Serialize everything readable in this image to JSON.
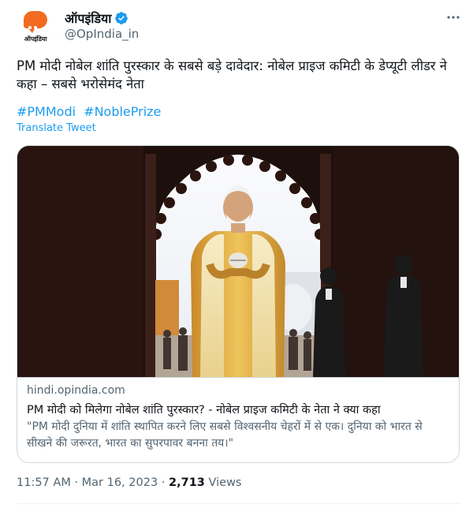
{
  "author": {
    "display_name": "ऑपइंडिया",
    "handle": "@OpIndia_in",
    "avatar_text": "ऑपइंडिया",
    "verified": true
  },
  "tweet": {
    "text": "PM मोदी नोबेल शांति पुरस्कार के सबसे बड़े दावेदार: नोबेल प्राइज कमिटी के डेप्यूटी लीडर ने कहा – सबसे भरोसेमंद नेता",
    "hashtags": [
      "#PMModi",
      "#NoblePrize"
    ],
    "translate_label": "Translate Tweet"
  },
  "card": {
    "domain": "hindi.opindia.com",
    "title": "PM मोदी को मिलेगा नोबेल शांति पुरस्कार? - नोबेल प्राइज कमिटी के नेता ने क्या कहा",
    "description": "\"PM मोदी दुनिया में शांति स्थापित करने लिए सबसे विश्वसनीय चेहरों में से एक। दुनिया को भारत से सीखने की जरूरत, भारत का सुपरपावर बनना तय।\""
  },
  "meta": {
    "time": "11:57 AM",
    "date": "Mar 16, 2023",
    "views_count": "2,713",
    "views_label": "Views"
  },
  "colors": {
    "link": "#1d9bf0",
    "secondary": "#536471",
    "brand": "#f26b21"
  }
}
